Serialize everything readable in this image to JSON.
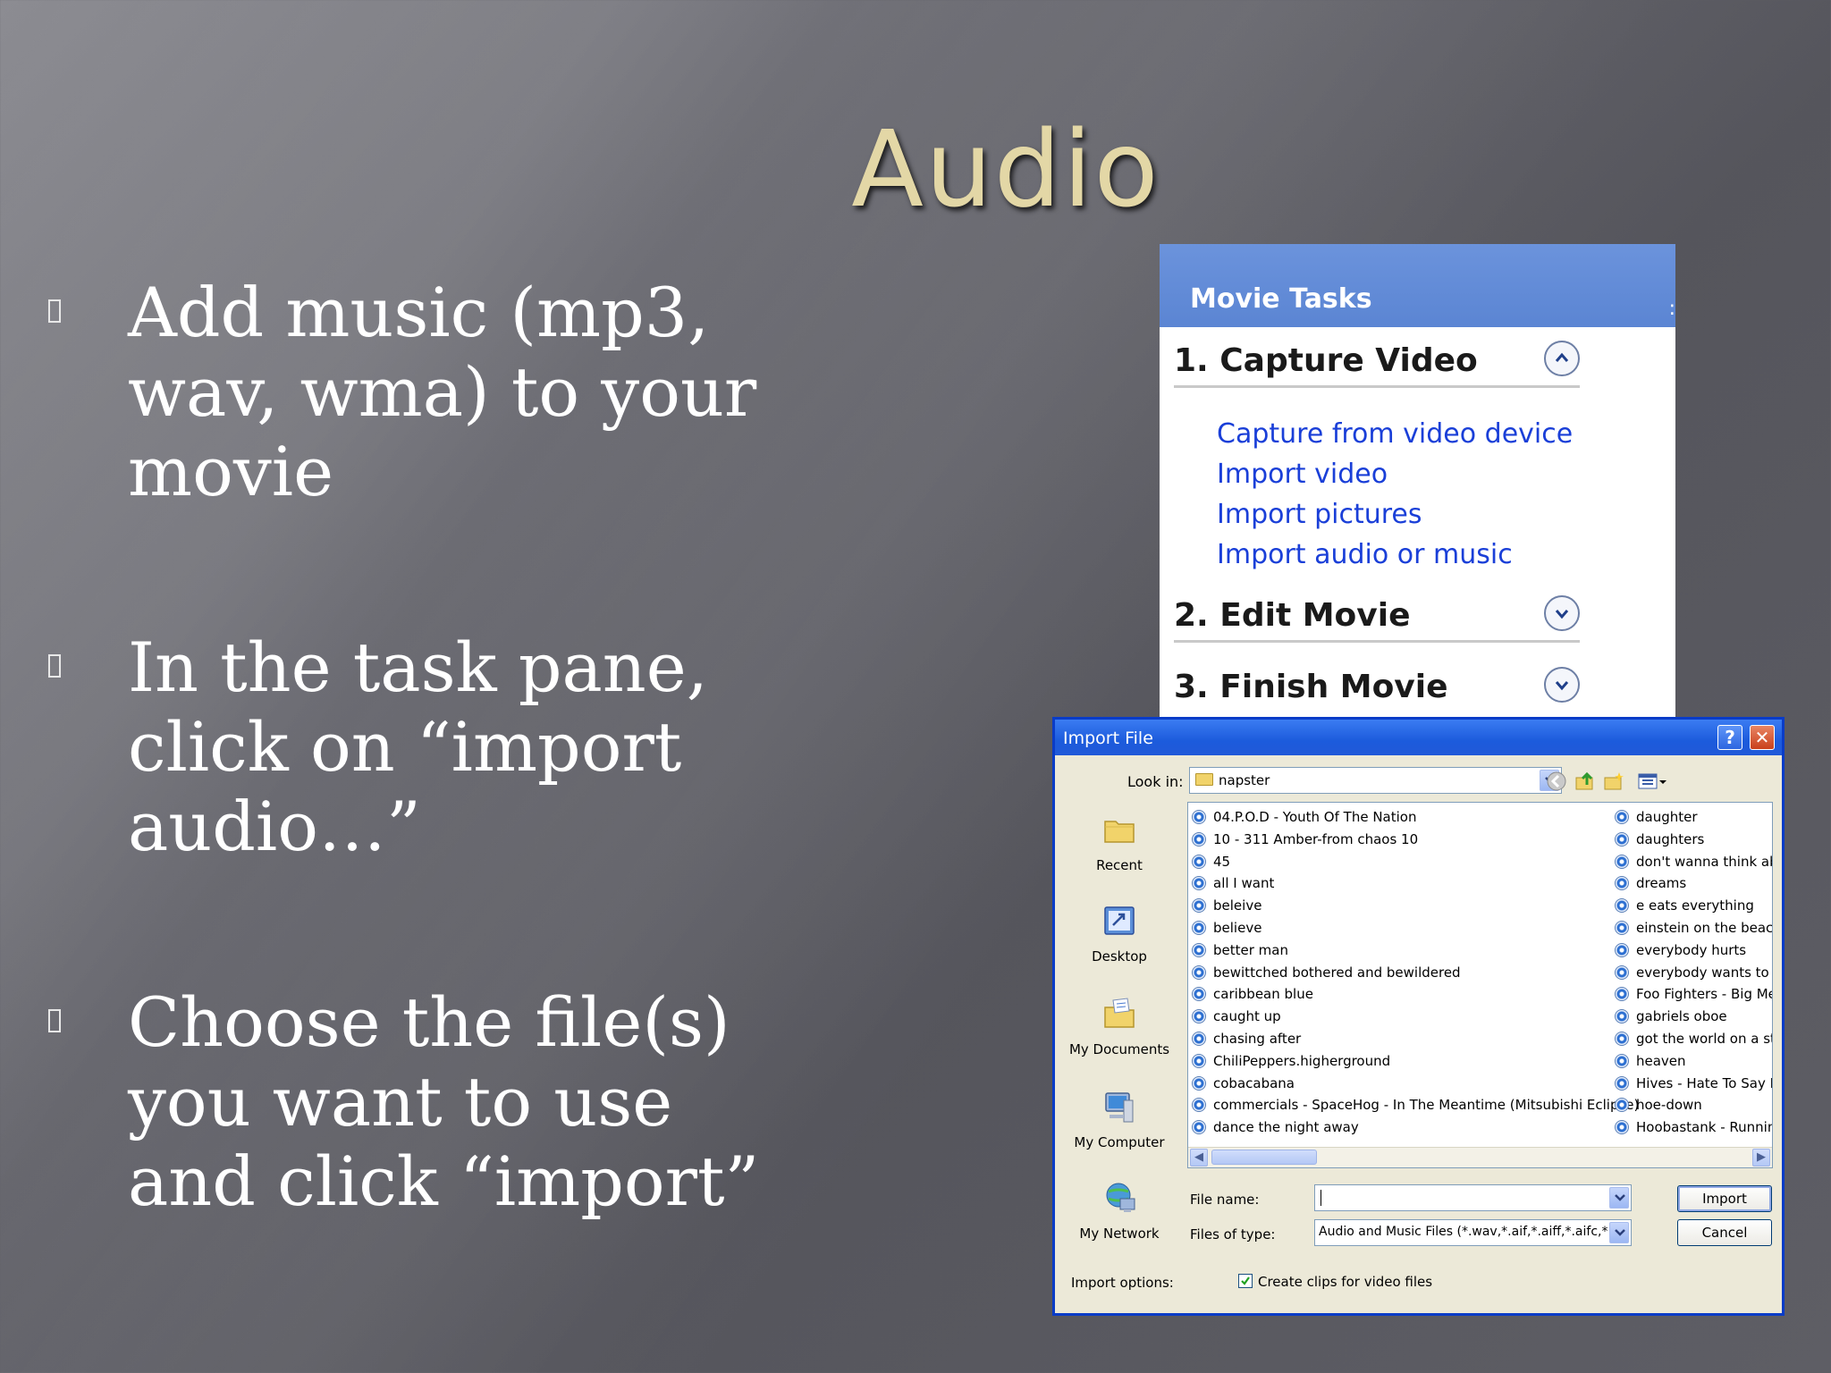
{
  "slide": {
    "title": "Audio",
    "bullets": [
      "Add music (mp3, wav, wma) to your movie",
      "In the task pane, click on “import audio…”",
      "Choose the file(s) you want to use and click “import”"
    ]
  },
  "task_pane": {
    "title": "Movie Tasks",
    "sections": [
      {
        "title": "1. Capture Video",
        "expanded": true,
        "links": [
          "Capture from video device",
          "Import video",
          "Import pictures",
          "Import audio or music"
        ]
      },
      {
        "title": "2. Edit Movie",
        "expanded": false
      },
      {
        "title": "3. Finish Movie",
        "expanded": false
      }
    ]
  },
  "dialog": {
    "title": "Import File",
    "look_in_label": "Look in:",
    "look_in_value": "napster",
    "places": [
      "Recent",
      "Desktop",
      "My Documents",
      "My Computer",
      "My Network"
    ],
    "files_col1": [
      "04.P.O.D - Youth Of The Nation",
      "10 - 311 Amber-from chaos 10",
      "45",
      "all I want",
      "beleive",
      "believe",
      "better man",
      "bewittched bothered and bewildered",
      "caribbean blue",
      "caught up",
      "chasing after",
      "ChiliPeppers.higherground",
      "cobacabana",
      "commercials - SpaceHog - In The Meantime (Mitsubishi Eclipse)",
      "dance the night away"
    ],
    "files_col2": [
      "daughter",
      "daughters",
      "don't wanna think abc",
      "dreams",
      "e eats everything",
      "einstein on the beach",
      "everybody hurts",
      "everybody wants to r",
      "Foo Fighters - Big Me",
      "gabriels oboe",
      "got the world on a str",
      "heaven",
      "Hives - Hate To Say I",
      "hoe-down",
      "Hoobastank - Running"
    ],
    "file_name_label": "File name:",
    "file_name_value": "",
    "files_of_type_label": "Files of type:",
    "files_of_type_value": "Audio and Music Files (*.wav,*.aif,*.aiff,*.aifc,*.s",
    "import_button": "Import",
    "cancel_button": "Cancel",
    "import_options_label": "Import options:",
    "create_clips_label": "Create clips for video files",
    "create_clips_checked": true,
    "help_glyph": "?",
    "close_glyph": "✕"
  },
  "colors": {
    "title_gold": "#e3d7a6",
    "pane_header": "#6b93dc",
    "link_blue": "#1a3fd8",
    "xp_titlebar": "#1c5bdc"
  }
}
